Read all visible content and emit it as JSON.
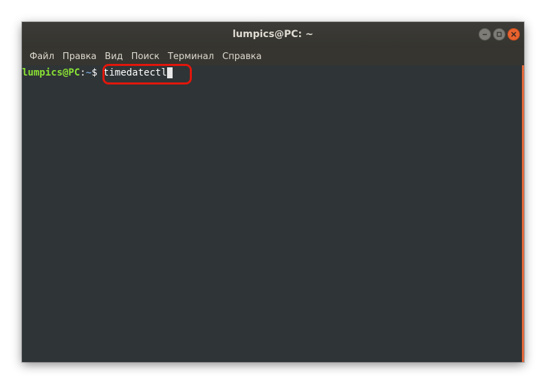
{
  "window": {
    "title": "lumpics@PC: ~"
  },
  "menu": {
    "items": [
      "Файл",
      "Правка",
      "Вид",
      "Поиск",
      "Терминал",
      "Справка"
    ]
  },
  "terminal": {
    "prompt_user": "lumpics@PC",
    "prompt_sep": ":",
    "prompt_path": "~",
    "prompt_symbol": "$ ",
    "command": "timedatectl"
  },
  "colors": {
    "prompt_user": "#8ae234",
    "prompt_path": "#729fcf",
    "terminal_bg": "#2f3436",
    "highlight": "#e3160b",
    "close_button": "#e9622e"
  },
  "icons": {
    "minimize": "minimize-icon",
    "maximize": "maximize-icon",
    "close": "close-icon"
  }
}
